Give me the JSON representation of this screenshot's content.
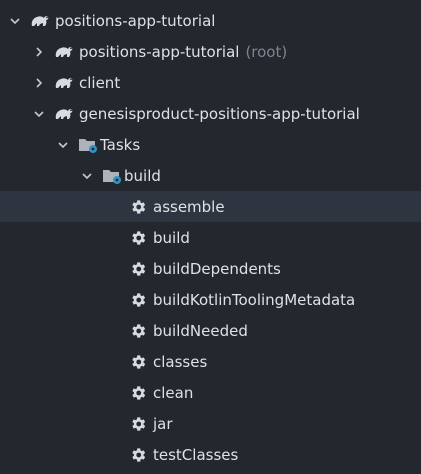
{
  "tree": {
    "root": {
      "label": "positions-app-tutorial",
      "expanded": true,
      "icon": "gradle-elephant-icon"
    },
    "children": [
      {
        "label": "positions-app-tutorial",
        "suffix": "(root)",
        "expanded": false,
        "icon": "gradle-elephant-icon"
      },
      {
        "label": "client",
        "expanded": false,
        "icon": "gradle-elephant-icon"
      },
      {
        "label": "genesisproduct-positions-app-tutorial",
        "expanded": true,
        "icon": "gradle-elephant-icon"
      }
    ],
    "tasks_folder": {
      "label": "Tasks",
      "expanded": true,
      "icon": "task-folder-icon"
    },
    "build_folder": {
      "label": "build",
      "expanded": true,
      "icon": "task-folder-icon"
    },
    "tasks": [
      {
        "label": "assemble",
        "selected": true
      },
      {
        "label": "build"
      },
      {
        "label": "buildDependents"
      },
      {
        "label": "buildKotlinToolingMetadata"
      },
      {
        "label": "buildNeeded"
      },
      {
        "label": "classes"
      },
      {
        "label": "clean"
      },
      {
        "label": "jar"
      },
      {
        "label": "testClasses"
      }
    ]
  },
  "colors": {
    "background": "#23272e",
    "text": "#dfe1e5",
    "muted": "#7f848e",
    "selection": "#2e3440",
    "gear": "#d7dae0",
    "folder_badge": "#3592c4"
  }
}
